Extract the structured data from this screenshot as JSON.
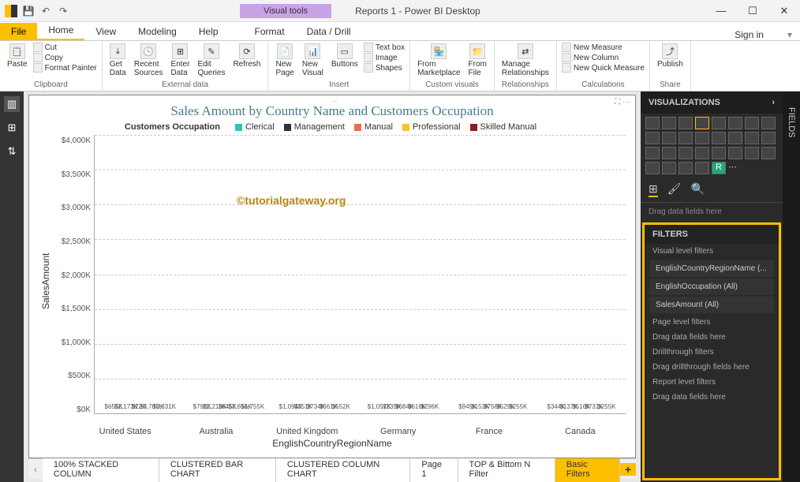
{
  "titlebar": {
    "visual_tools": "Visual tools",
    "title": "Reports 1 - Power BI Desktop",
    "signin": "Sign in"
  },
  "menu": {
    "file": "File",
    "tabs": [
      "Home",
      "View",
      "Modeling",
      "Help",
      "Format",
      "Data / Drill"
    ]
  },
  "ribbon": {
    "clipboard": {
      "label": "Clipboard",
      "paste": "Paste",
      "cut": "Cut",
      "copy": "Copy",
      "fp": "Format Painter"
    },
    "external": {
      "label": "External data",
      "get": "Get\nData",
      "recent": "Recent\nSources",
      "enter": "Enter\nData",
      "edit": "Edit\nQueries",
      "refresh": "Refresh"
    },
    "insert": {
      "label": "Insert",
      "page": "New\nPage",
      "visual": "New\nVisual",
      "buttons": "Buttons",
      "text": "Text box",
      "image": "Image",
      "shapes": "Shapes"
    },
    "custom": {
      "label": "Custom visuals",
      "market": "From\nMarketplace",
      "file": "From\nFile"
    },
    "rel": {
      "label": "Relationships",
      "manage": "Manage\nRelationships"
    },
    "calc": {
      "label": "Calculations",
      "measure": "New Measure",
      "column": "New Column",
      "quick": "New Quick Measure"
    },
    "share": {
      "label": "Share",
      "publish": "Publish"
    }
  },
  "chart_data": {
    "type": "bar",
    "title": "Sales Amount by Country Name and Customers Occupation",
    "xlabel": "EnglishCountryRegionName",
    "ylabel": "SalesAmount",
    "legend_title": "Customers Occupation",
    "ylim": [
      0,
      4000000
    ],
    "yticks": [
      "$4,000K",
      "$3,500K",
      "$3,000K",
      "$2,500K",
      "$2,000K",
      "$1,500K",
      "$1,000K",
      "$500K",
      "$0K"
    ],
    "series": [
      {
        "name": "Clerical",
        "color": "#2ec4b6"
      },
      {
        "name": "Management",
        "color": "#2d3142"
      },
      {
        "name": "Manual",
        "color": "#e76f51"
      },
      {
        "name": "Professional",
        "color": "#f4c430"
      },
      {
        "name": "Skilled Manual",
        "color": "#8b1e1e"
      }
    ],
    "categories": [
      "United States",
      "Australia",
      "United Kingdom",
      "Germany",
      "France",
      "Canada"
    ],
    "data": {
      "United States": {
        "Clerical": 655,
        "Management": 2173,
        "Manual": 22,
        "Professional": 3709,
        "Skilled Manual": 2831
      },
      "Australia": {
        "Clerical": 792,
        "Management": 2213,
        "Manual": 645,
        "Professional": 3656,
        "Skilled Manual": 1755
      },
      "United Kingdom": {
        "Clerical": 1094,
        "Management": 351,
        "Manual": 734,
        "Professional": 661,
        "Skilled Manual": 552
      },
      "Germany": {
        "Clerical": 1057,
        "Management": 235,
        "Manual": 684,
        "Professional": 616,
        "Skilled Manual": 296
      },
      "France": {
        "Clerical": 949,
        "Management": 153,
        "Manual": 758,
        "Professional": 529,
        "Skilled Manual": 255
      },
      "Canada": {
        "Clerical": 344,
        "Management": 137,
        "Manual": 516,
        "Professional": 731,
        "Skilled Manual": 255
      }
    },
    "labels": {
      "United States": [
        "$655K",
        "$2,173K",
        "$22K",
        "$3,709K",
        "$2,831K"
      ],
      "Australia": [
        "$792K",
        "$2,213K",
        "$645K",
        "$3,656K",
        "$1,755K"
      ],
      "United Kingdom": [
        "$1,094K",
        "$351K",
        "$734K",
        "$661K",
        "$552K"
      ],
      "Germany": [
        "$1,057K",
        "$235K",
        "$684K",
        "$616K",
        "$296K"
      ],
      "France": [
        "$949K",
        "$153K",
        "$758K",
        "$529K",
        "$255K"
      ],
      "Canada": [
        "$344K",
        "$137K",
        "$516K",
        "$731K",
        "$255K"
      ]
    }
  },
  "watermark": "©tutorialgateway.org",
  "page_tabs": [
    "100% STACKED COLUMN",
    "CLUSTERED BAR CHART",
    "CLUSTERED COLUMN CHART",
    "Page 1",
    "TOP & Bittom N Filter",
    "Basic Filters"
  ],
  "right": {
    "viz": "VISUALIZATIONS",
    "drag": "Drag data fields here",
    "filters": "FILTERS",
    "vlf": "Visual level filters",
    "fitems": [
      "EnglishCountryRegionName (...",
      "EnglishOccupation (All)",
      "SalesAmount (All)"
    ],
    "plf": "Page level filters",
    "plf_drop": "Drag data fields here",
    "dtf": "Drillthrough filters",
    "dtf_drop": "Drag drillthrough fields here",
    "rlf": "Report level filters",
    "rlf_drop": "Drag data fields here",
    "fields": "FIELDS"
  }
}
